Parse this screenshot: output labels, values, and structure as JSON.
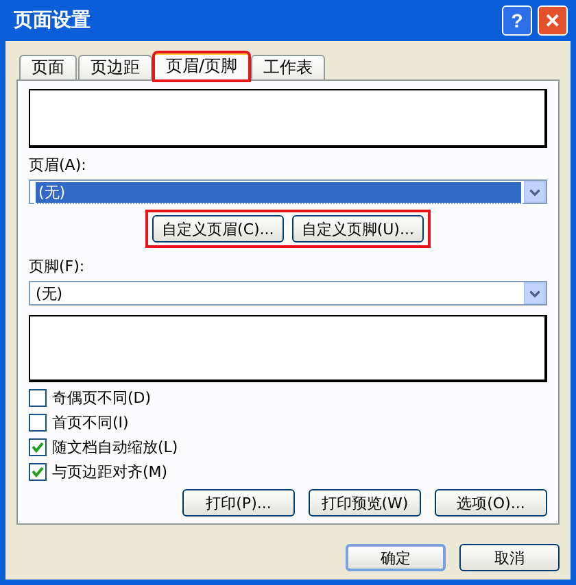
{
  "window": {
    "title": "页面设置"
  },
  "title_buttons": [
    {
      "kind": "help",
      "label": "?"
    },
    {
      "kind": "close",
      "label": "✕"
    }
  ],
  "tabs": [
    {
      "label": "页面",
      "selected": false,
      "highlighted": false
    },
    {
      "label": "页边距",
      "selected": false,
      "highlighted": false
    },
    {
      "label": "页眉/页脚",
      "selected": true,
      "highlighted": true
    },
    {
      "label": "工作表",
      "selected": false,
      "highlighted": false
    }
  ],
  "header": {
    "label": "页眉(A):",
    "value": "(无)",
    "focused": true
  },
  "custom_buttons": {
    "highlighted": true,
    "buttons": [
      "自定义页眉(C)...",
      "自定义页脚(U)..."
    ]
  },
  "footer": {
    "label": "页脚(F):",
    "value": "(无)",
    "focused": false
  },
  "options": [
    {
      "label": "奇偶页不同(D)",
      "checked": false
    },
    {
      "label": "首页不同(I)",
      "checked": false
    },
    {
      "label": "随文档自动缩放(L)",
      "checked": true
    },
    {
      "label": "与页边距对齐(M)",
      "checked": true
    }
  ],
  "panel_buttons": [
    "打印(P)...",
    "打印预览(W)",
    "选项(O)..."
  ],
  "dialog_buttons": [
    {
      "label": "确定",
      "default": true
    },
    {
      "label": "取消",
      "default": false
    }
  ]
}
